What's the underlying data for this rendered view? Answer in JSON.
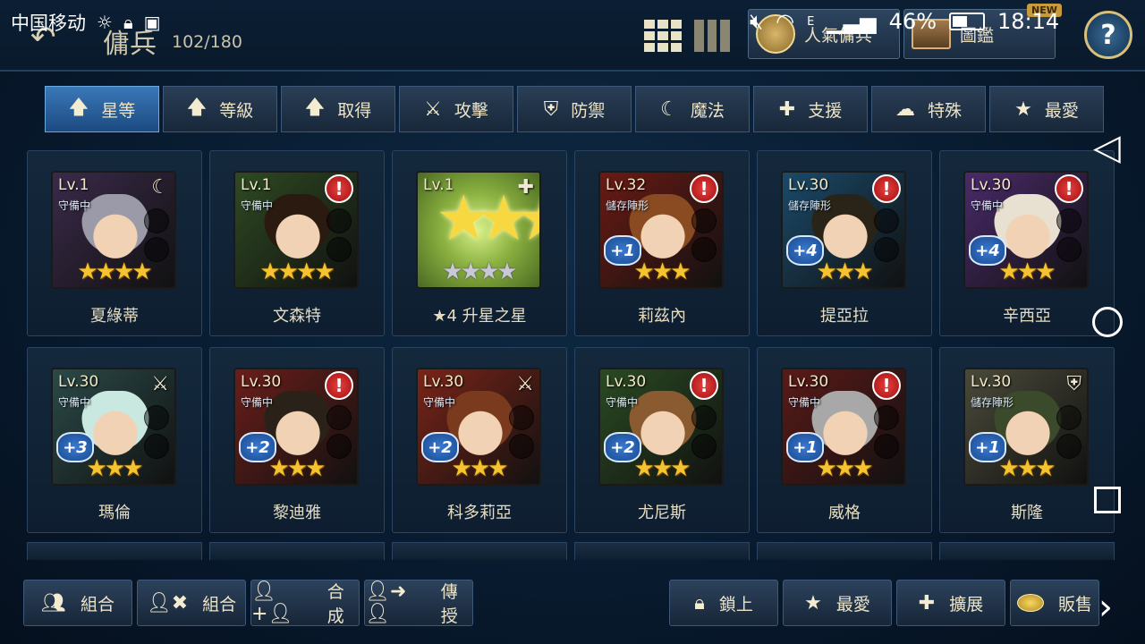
{
  "status_bar": {
    "carrier": "中国移动",
    "network": "E",
    "battery": "46%",
    "time": "18:14"
  },
  "header": {
    "title": "傭兵",
    "unit_count": "102/180",
    "popular_label": "人氣傭兵",
    "codex_label": "圖鑑",
    "new_badge": "NEW",
    "help_label": "?"
  },
  "tabs": [
    {
      "label": "星等",
      "icon": "arrow-up-icon",
      "glyph": "🡅",
      "active": true
    },
    {
      "label": "等級",
      "icon": "arrow-up-icon",
      "glyph": "🡅",
      "active": false
    },
    {
      "label": "取得",
      "icon": "arrow-up-icon",
      "glyph": "🡅",
      "active": false
    },
    {
      "label": "攻擊",
      "icon": "sword-icon",
      "glyph": "⚔",
      "active": false
    },
    {
      "label": "防禦",
      "icon": "shield-icon",
      "glyph": "⛨",
      "active": false
    },
    {
      "label": "魔法",
      "icon": "witch-hat-icon",
      "glyph": "☾",
      "active": false
    },
    {
      "label": "支援",
      "icon": "support-icon",
      "glyph": "✚",
      "active": false
    },
    {
      "label": "特殊",
      "icon": "slime-icon",
      "glyph": "☁",
      "active": false
    },
    {
      "label": "最愛",
      "icon": "star-icon",
      "glyph": "★",
      "active": false
    }
  ],
  "heroes": [
    {
      "name": "夏綠蒂",
      "level": "Lv.1",
      "status": "守備中",
      "class_icon": "witch-hat-icon",
      "class_glyph": "☾",
      "alert": false,
      "plus": "",
      "stars": "★★★★",
      "bg": "#3a2a4a",
      "hair": "#9a9aa8"
    },
    {
      "name": "文森特",
      "level": "Lv.1",
      "status": "守備中",
      "class_icon": "",
      "class_glyph": "",
      "alert": true,
      "plus": "",
      "stars": "★★★★",
      "bg": "#2e4a22",
      "hair": "#2a1a10"
    },
    {
      "name": "★4 升星之星",
      "level": "Lv.1",
      "status": "",
      "class_icon": "support-icon",
      "class_glyph": "✚",
      "alert": false,
      "plus": "",
      "stars": "★★★★",
      "bg": "",
      "hair": "",
      "is_item": true
    },
    {
      "name": "莉茲內",
      "level": "Lv.32",
      "status": "儲存陣形",
      "class_icon": "",
      "class_glyph": "",
      "alert": true,
      "plus": "+1",
      "stars": "★★★",
      "bg": "#6a1a14",
      "hair": "#8a4a22"
    },
    {
      "name": "提亞拉",
      "level": "Lv.30",
      "status": "儲存陣形",
      "class_icon": "",
      "class_glyph": "",
      "alert": true,
      "plus": "+4",
      "stars": "★★★",
      "bg": "#1a4a6a",
      "hair": "#2a2418"
    },
    {
      "name": "辛西亞",
      "level": "Lv.30",
      "status": "守備中",
      "class_icon": "",
      "class_glyph": "",
      "alert": true,
      "plus": "+4",
      "stars": "★★★",
      "bg": "#4a2a6a",
      "hair": "#e8e0d0"
    },
    {
      "name": "瑪倫",
      "level": "Lv.30",
      "status": "守備中",
      "class_icon": "sword-icon",
      "class_glyph": "⚔",
      "alert": false,
      "plus": "+3",
      "stars": "★★★",
      "bg": "#2a4a48",
      "hair": "#c8e8e0"
    },
    {
      "name": "黎迪雅",
      "level": "Lv.30",
      "status": "守備中",
      "class_icon": "",
      "class_glyph": "",
      "alert": true,
      "plus": "+2",
      "stars": "★★★",
      "bg": "#6a1e1a",
      "hair": "#2a2218"
    },
    {
      "name": "科多莉亞",
      "level": "Lv.30",
      "status": "守備中",
      "class_icon": "sword-icon",
      "class_glyph": "⚔",
      "alert": false,
      "plus": "+2",
      "stars": "★★★",
      "bg": "#7a2418",
      "hair": "#7a3a1e"
    },
    {
      "name": "尤尼斯",
      "level": "Lv.30",
      "status": "守備中",
      "class_icon": "",
      "class_glyph": "",
      "alert": true,
      "plus": "+2",
      "stars": "★★★",
      "bg": "#2a4a22",
      "hair": "#8a5a30"
    },
    {
      "name": "威格",
      "level": "Lv.30",
      "status": "守備中",
      "class_icon": "",
      "class_glyph": "",
      "alert": true,
      "plus": "+1",
      "stars": "★★★",
      "bg": "#5a1a18",
      "hair": "#a8a8a8"
    },
    {
      "name": "斯隆",
      "level": "Lv.30",
      "status": "儲存陣形",
      "class_icon": "shield-icon",
      "class_glyph": "⛨",
      "alert": false,
      "plus": "+1",
      "stars": "★★★",
      "bg": "#4a4a3a",
      "hair": "#3a4a2a"
    }
  ],
  "bottom_bar": {
    "combo1_label": "組合",
    "combo2_label": "組合",
    "fuse_label": "合成",
    "teach_label": "傳授",
    "lock_label": "鎖上",
    "favorite_label": "最愛",
    "expand_label": "擴展",
    "sell_label": "販售"
  }
}
